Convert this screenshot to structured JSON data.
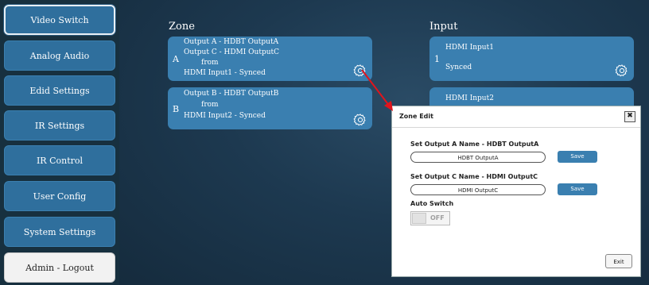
{
  "sidebar": {
    "items": [
      {
        "label": "Video Switch"
      },
      {
        "label": "Analog Audio"
      },
      {
        "label": "Edid Settings"
      },
      {
        "label": "IR Settings"
      },
      {
        "label": "IR Control"
      },
      {
        "label": "User Config"
      },
      {
        "label": "System Settings"
      },
      {
        "label": "Admin - Logout"
      }
    ]
  },
  "zone": {
    "title": "Zone",
    "cards": [
      {
        "letter": "A",
        "lines": [
          "Output A -    HDBT OutputA",
          "Output C -    HDMI OutputC",
          "from",
          "HDMI Input1 - Synced"
        ]
      },
      {
        "letter": "B",
        "lines": [
          "Output B -    HDBT OutputB",
          "from",
          "HDMI Input2 - Synced"
        ]
      }
    ]
  },
  "input": {
    "title": "Input",
    "cards": [
      {
        "number": "1",
        "name": "HDMI Input1",
        "status": "Synced"
      },
      {
        "name": "HDMI Input2"
      }
    ]
  },
  "dialog": {
    "title": "Zone Edit",
    "close": "✖",
    "field_a_label": "Set Output A Name - HDBT OutputA",
    "field_a_value": "HDBT OutputA",
    "field_c_label": "Set Output C Name - HDMI OutputC",
    "field_c_value": "HDMI OutputC",
    "save_label": "Save",
    "auto_switch_label": "Auto Switch",
    "auto_switch_state": "OFF",
    "exit_label": "Exit"
  },
  "colors": {
    "accent": "#3a7fb0",
    "background": "#1d3950",
    "arrow": "#e0141c"
  },
  "icons": {
    "gear": "gear-icon",
    "arrow": "red-arrow-annotation"
  }
}
